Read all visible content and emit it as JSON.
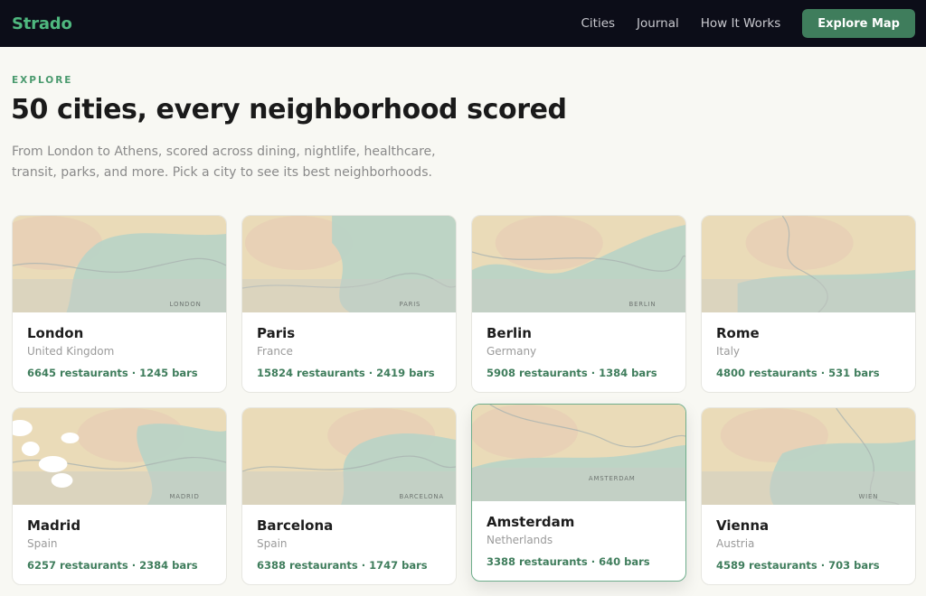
{
  "brand": {
    "logo": "Strado"
  },
  "nav": {
    "links": [
      "Cities",
      "Journal",
      "How It Works"
    ],
    "cta": "Explore Map"
  },
  "hero": {
    "eyebrow": "EXPLORE",
    "title": "50 cities, every neighborhood scored",
    "subtitle": "From London to Athens, scored across dining, nightlife, healthcare, transit, parks, and more. Pick a city to see its best neighborhoods."
  },
  "cities": [
    {
      "name": "London",
      "country": "United Kingdom",
      "stats": "6645 restaurants · 1245 bars",
      "map_label": "LONDON"
    },
    {
      "name": "Paris",
      "country": "France",
      "stats": "15824 restaurants · 2419 bars",
      "map_label": "PARIS"
    },
    {
      "name": "Berlin",
      "country": "Germany",
      "stats": "5908 restaurants · 1384 bars",
      "map_label": "BERLIN"
    },
    {
      "name": "Rome",
      "country": "Italy",
      "stats": "4800 restaurants · 531 bars",
      "map_label": ""
    },
    {
      "name": "Madrid",
      "country": "Spain",
      "stats": "6257 restaurants · 2384 bars",
      "map_label": "MADRID"
    },
    {
      "name": "Barcelona",
      "country": "Spain",
      "stats": "6388 restaurants · 1747 bars",
      "map_label": "BARCELONA"
    },
    {
      "name": "Amsterdam",
      "country": "Netherlands",
      "stats": "3388 restaurants · 640 bars",
      "map_label": "AMSTERDAM"
    },
    {
      "name": "Vienna",
      "country": "Austria",
      "stats": "4589 restaurants · 703 bars",
      "map_label": "WIEN"
    }
  ],
  "colors": {
    "nav_bg": "#0c0d18",
    "brand_green": "#4fb87f",
    "cta_green": "#3f7d5c",
    "map_warm": "#eadbb8",
    "map_cool": "#b8d3c6"
  }
}
